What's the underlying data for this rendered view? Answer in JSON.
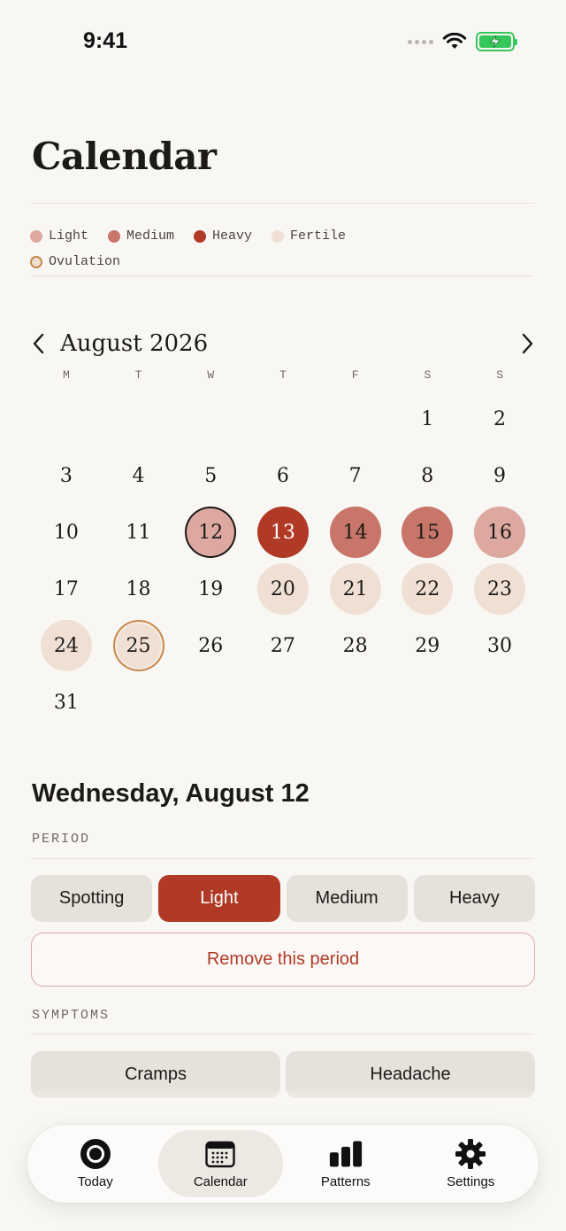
{
  "status": {
    "time": "9:41"
  },
  "page": {
    "title": "Calendar"
  },
  "legend": [
    {
      "label": "Light",
      "color": "#dca89f",
      "style": "fill"
    },
    {
      "label": "Medium",
      "color": "#c8766a",
      "style": "fill"
    },
    {
      "label": "Heavy",
      "color": "#b03a26",
      "style": "fill"
    },
    {
      "label": "Fertile",
      "color": "#efe0d3",
      "style": "fill"
    },
    {
      "label": "Ovulation",
      "color": "#c7884d",
      "style": "ring"
    }
  ],
  "calendar": {
    "month_label": "August 2026",
    "weekdays": [
      "M",
      "T",
      "W",
      "T",
      "F",
      "S",
      "S"
    ],
    "leading_blanks": 5,
    "days": [
      {
        "d": "1"
      },
      {
        "d": "2"
      },
      {
        "d": "3"
      },
      {
        "d": "4"
      },
      {
        "d": "5"
      },
      {
        "d": "6"
      },
      {
        "d": "7"
      },
      {
        "d": "8"
      },
      {
        "d": "9"
      },
      {
        "d": "10"
      },
      {
        "d": "11"
      },
      {
        "d": "12",
        "state": "light",
        "selected": true
      },
      {
        "d": "13",
        "state": "heavy"
      },
      {
        "d": "14",
        "state": "medium"
      },
      {
        "d": "15",
        "state": "medium"
      },
      {
        "d": "16",
        "state": "light"
      },
      {
        "d": "17"
      },
      {
        "d": "18"
      },
      {
        "d": "19"
      },
      {
        "d": "20",
        "state": "fertile"
      },
      {
        "d": "21",
        "state": "fertile"
      },
      {
        "d": "22",
        "state": "fertile"
      },
      {
        "d": "23",
        "state": "fertile"
      },
      {
        "d": "24",
        "state": "fertile"
      },
      {
        "d": "25",
        "state": "ovulation"
      },
      {
        "d": "26"
      },
      {
        "d": "27"
      },
      {
        "d": "28"
      },
      {
        "d": "29"
      },
      {
        "d": "30"
      },
      {
        "d": "31"
      }
    ]
  },
  "detail": {
    "date_title": "Wednesday, August 12",
    "period_label": "PERIOD",
    "flow_options": [
      {
        "label": "Spotting",
        "active": false
      },
      {
        "label": "Light",
        "active": true
      },
      {
        "label": "Medium",
        "active": false
      },
      {
        "label": "Heavy",
        "active": false
      }
    ],
    "remove_label": "Remove this period",
    "symptoms_label": "SYMPTOMS",
    "symptoms": [
      "Cramps",
      "Headache"
    ]
  },
  "tabs": [
    {
      "label": "Today",
      "icon": "today-ring-icon",
      "active": false
    },
    {
      "label": "Calendar",
      "icon": "calendar-icon",
      "active": true
    },
    {
      "label": "Patterns",
      "icon": "bar-chart-icon",
      "active": false
    },
    {
      "label": "Settings",
      "icon": "gear-icon",
      "active": false
    }
  ],
  "colors": {
    "light": "#dca89f",
    "medium": "#c8766a",
    "heavy": "#b03a26",
    "fertile": "#efe0d3",
    "ovulation_fill": "#efe0d3",
    "ovulation_ring": "#c7884d",
    "accent": "#b03a26"
  }
}
